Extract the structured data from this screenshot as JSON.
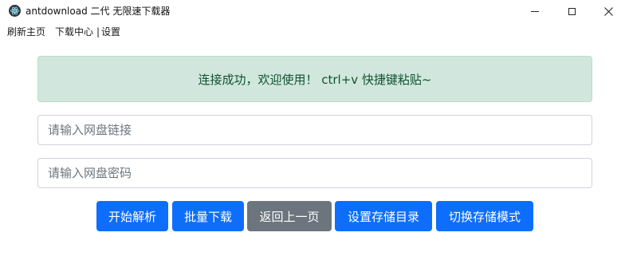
{
  "window": {
    "title": "antdownload 二代 无限速下载器",
    "app_icon": "electron-icon",
    "controls": {
      "minimize_icon": "minimize-icon",
      "maximize_icon": "maximize-icon",
      "close_icon": "close-icon"
    }
  },
  "menu": {
    "home": "刷新主页",
    "download_center": "下载中心",
    "separator": "|",
    "settings": "设置"
  },
  "alert": {
    "message": "连接成功，欢迎使用！ ctrl+v 快捷键粘贴~",
    "bg_color": "#d1e7dd",
    "text_color": "#0f5132"
  },
  "form": {
    "link_placeholder": "请输入网盘链接",
    "link_value": "",
    "password_placeholder": "请输入网盘密码",
    "password_value": ""
  },
  "buttons": {
    "parse": "开始解析",
    "batch_download": "批量下载",
    "back": "返回上一页",
    "set_directory": "设置存储目录",
    "switch_mode": "切换存储模式"
  },
  "colors": {
    "primary": "#0d6efd",
    "secondary": "#6c757d"
  }
}
